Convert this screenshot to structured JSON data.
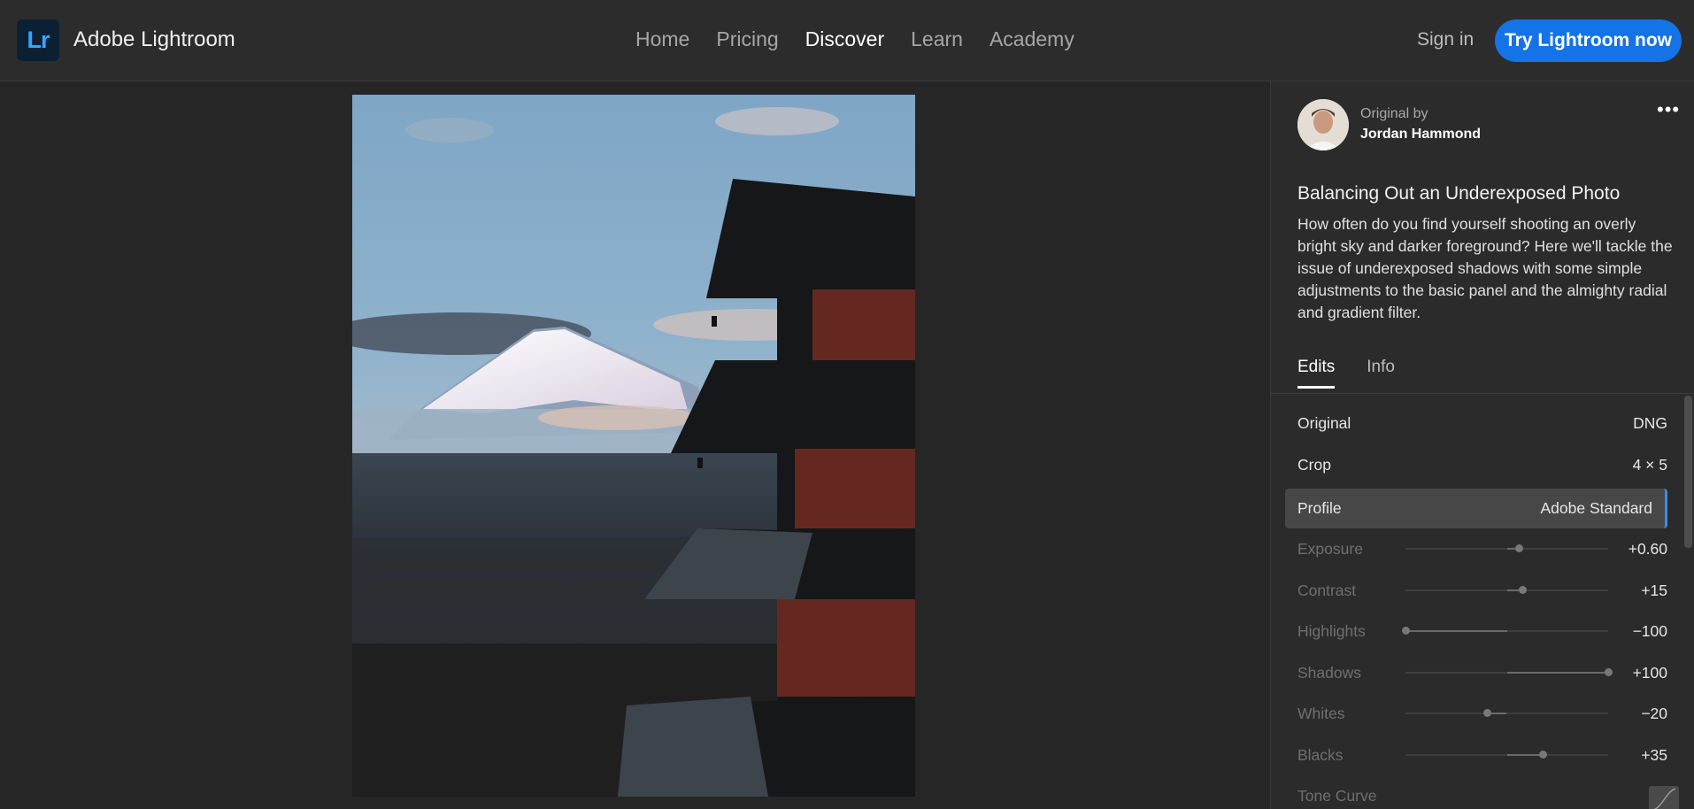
{
  "app": {
    "logo_text": "Lr",
    "brand": "Adobe Lightroom"
  },
  "nav": {
    "items": [
      "Home",
      "Pricing",
      "Discover",
      "Learn",
      "Academy"
    ],
    "active": "Discover"
  },
  "header": {
    "signin": "Sign in",
    "cta": "Try Lightroom now"
  },
  "author": {
    "original_by": "Original by",
    "name": "Jordan Hammond"
  },
  "edit": {
    "title": "Balancing Out an Underexposed Photo",
    "description": "How often do you find yourself shooting an overly bright sky and darker foreground? Here we'll tackle the issue of underexposed shadows with some simple adjustments to the basic panel and the almighty radial and gradient filter."
  },
  "tabs": [
    "Edits",
    "Info"
  ],
  "settings": {
    "original": {
      "label": "Original",
      "value": "DNG"
    },
    "crop": {
      "label": "Crop",
      "value": "4 × 5"
    },
    "profile": {
      "label": "Profile",
      "value": "Adobe Standard"
    },
    "sliders": [
      {
        "label": "Exposure",
        "value": "+0.60",
        "amount": 0.12
      },
      {
        "label": "Contrast",
        "value": "+15",
        "amount": 0.15
      },
      {
        "label": "Highlights",
        "value": "−100",
        "amount": -1.0
      },
      {
        "label": "Shadows",
        "value": "+100",
        "amount": 1.0
      },
      {
        "label": "Whites",
        "value": "−20",
        "amount": -0.2
      },
      {
        "label": "Blacks",
        "value": "+35",
        "amount": 0.35
      }
    ],
    "tone_curve": {
      "label": "Tone Curve"
    }
  },
  "colors": {
    "accent": "#1473e6",
    "logo_bg": "#0c2033",
    "logo_fg": "#31a8ff",
    "selected_bar": "#3a8de8"
  }
}
